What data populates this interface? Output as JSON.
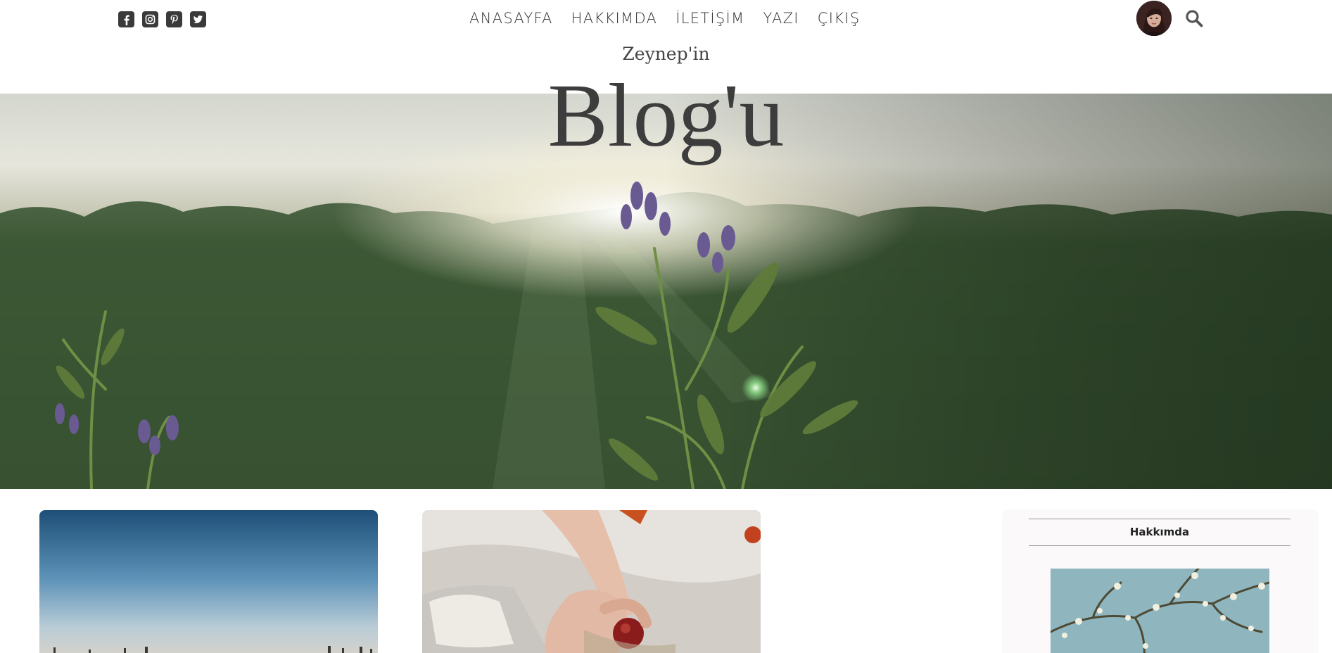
{
  "nav": {
    "items": [
      {
        "label": "ANASAYFA"
      },
      {
        "label": "HAKKIMDA"
      },
      {
        "label": "İLETİŞİM"
      },
      {
        "label": "YAZI"
      },
      {
        "label": "ÇIKIŞ"
      }
    ]
  },
  "social": [
    "facebook-icon",
    "instagram-icon",
    "pinterest-icon",
    "twitter-icon"
  ],
  "hero": {
    "subtitle": "Zeynep'in",
    "title": "Blog'u"
  },
  "sidebar": {
    "widget_title": "Hakkımda"
  },
  "colors": {
    "text": "#333333",
    "icon": "#3a3a3a",
    "sidebar_bg": "#fbf9f9"
  }
}
